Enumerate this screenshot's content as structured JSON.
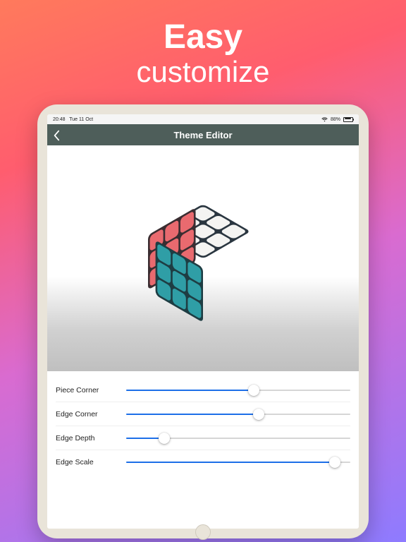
{
  "hero": {
    "line1": "Easy",
    "line2": "customize"
  },
  "statusbar": {
    "time": "20:48",
    "date": "Tue 11 Oct",
    "battery_pct": "88%"
  },
  "titlebar": {
    "title": "Theme Editor"
  },
  "sliders": [
    {
      "label": "Piece Corner",
      "value": 0.57
    },
    {
      "label": "Edge Corner",
      "value": 0.59
    },
    {
      "label": "Edge Depth",
      "value": 0.17
    },
    {
      "label": "Edge Scale",
      "value": 0.93
    }
  ],
  "colors": {
    "accent": "#1d6fe8",
    "titlebar_bg": "#4e5e5a",
    "cube_top": "#f4f4f2",
    "cube_left": "#e96a6f",
    "cube_right": "#2f9ea6"
  }
}
